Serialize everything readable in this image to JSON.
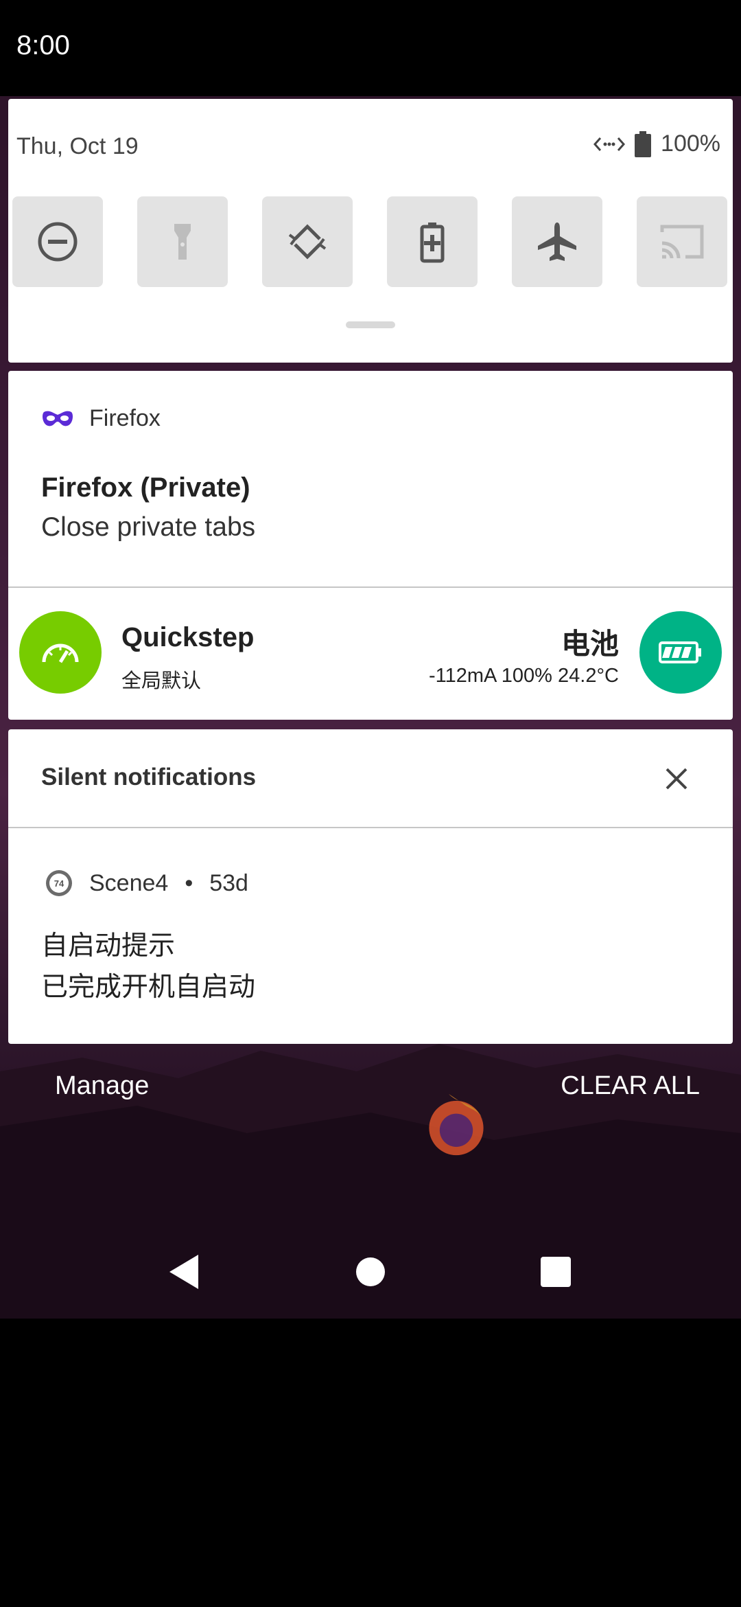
{
  "status_bar": {
    "time": "8:00"
  },
  "quick_settings": {
    "date": "Thu, Oct 19",
    "battery_percent": "100%",
    "tiles": [
      {
        "icon": "do-not-disturb-icon",
        "active": false
      },
      {
        "icon": "flashlight-icon",
        "active": false
      },
      {
        "icon": "auto-rotate-icon",
        "active": false
      },
      {
        "icon": "battery-saver-icon",
        "active": false
      },
      {
        "icon": "airplane-mode-icon",
        "active": false
      },
      {
        "icon": "cast-icon",
        "active": false
      }
    ]
  },
  "firefox_notification": {
    "app_name": "Firefox",
    "title": "Firefox (Private)",
    "text": "Close private tabs",
    "icon": "private-mask-icon",
    "icon_color": "#5b2bd6"
  },
  "quickstep_notification": {
    "title": "Quickstep",
    "subtitle": "全局默认",
    "left_icon": "speedometer-icon",
    "left_color": "#77cc00",
    "battery_title": "电池",
    "battery_detail": "-112mA 100% 24.2°C",
    "right_icon": "battery-icon",
    "right_color": "#00b386"
  },
  "silent_section": {
    "title": "Silent notifications",
    "scene_app": "Scene4",
    "scene_time": "53d",
    "scene_badge": "74",
    "line1": "自启动提示",
    "line2": "已完成开机自启动"
  },
  "footer": {
    "manage_label": "Manage",
    "clear_all_label": "CLEAR ALL"
  },
  "nav": {
    "back": "back-icon",
    "home": "home-icon",
    "recents": "recents-icon"
  }
}
